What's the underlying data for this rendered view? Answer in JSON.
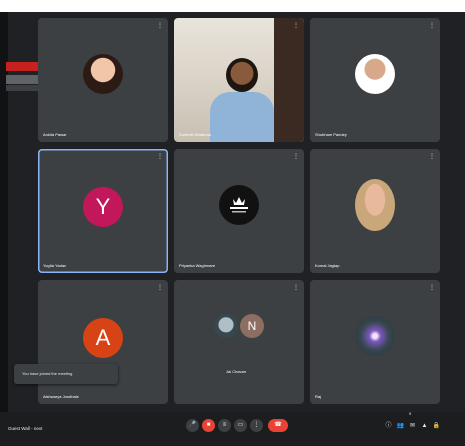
{
  "participants": [
    {
      "name": "Ankita Pawar",
      "mic_icon": "⋮",
      "kind": "photo"
    },
    {
      "name": "Sumedh Bhalerao",
      "mic_icon": "⋮",
      "kind": "video"
    },
    {
      "name": "Shubham Pandey",
      "mic_icon": "⋮",
      "kind": "photo"
    },
    {
      "name": "Yogita Yadav",
      "initial": "Y",
      "mic_icon": "⋮",
      "avatar_color": "#c2185b",
      "kind": "letter"
    },
    {
      "name": "Priyanka Waghmare",
      "mic_icon": "⋮",
      "kind": "logo"
    },
    {
      "name": "Komal Jagtap",
      "mic_icon": "⋮",
      "kind": "photo"
    },
    {
      "name": "Aishwarya Jondhale",
      "initial": "A",
      "mic_icon": "⋮",
      "avatar_color": "#d84315",
      "kind": "letter"
    },
    {
      "name": "Jai Chavan",
      "initial": "N",
      "mic_icon": "⋮",
      "kind": "pair"
    },
    {
      "name": "Raj",
      "mic_icon": "⋮",
      "kind": "galaxy"
    }
  ],
  "toast": {
    "text": "You have joined the meeting"
  },
  "bottom": {
    "meeting_title": "Guest Wall - next"
  },
  "controls": {
    "mic": "🎤",
    "cam": "■",
    "captions": "≡",
    "present": "▭",
    "more": "⋮",
    "hangup": "☎"
  },
  "right_icons": {
    "info": "ⓘ",
    "people": "👥",
    "chat": "✉",
    "activities": "▲",
    "lock": "🔒"
  },
  "people_badge": "9",
  "colors": {
    "active_border": "#8ab4f8",
    "hangup": "#ea4335",
    "tile": "#3c4043",
    "background": "#202124"
  }
}
